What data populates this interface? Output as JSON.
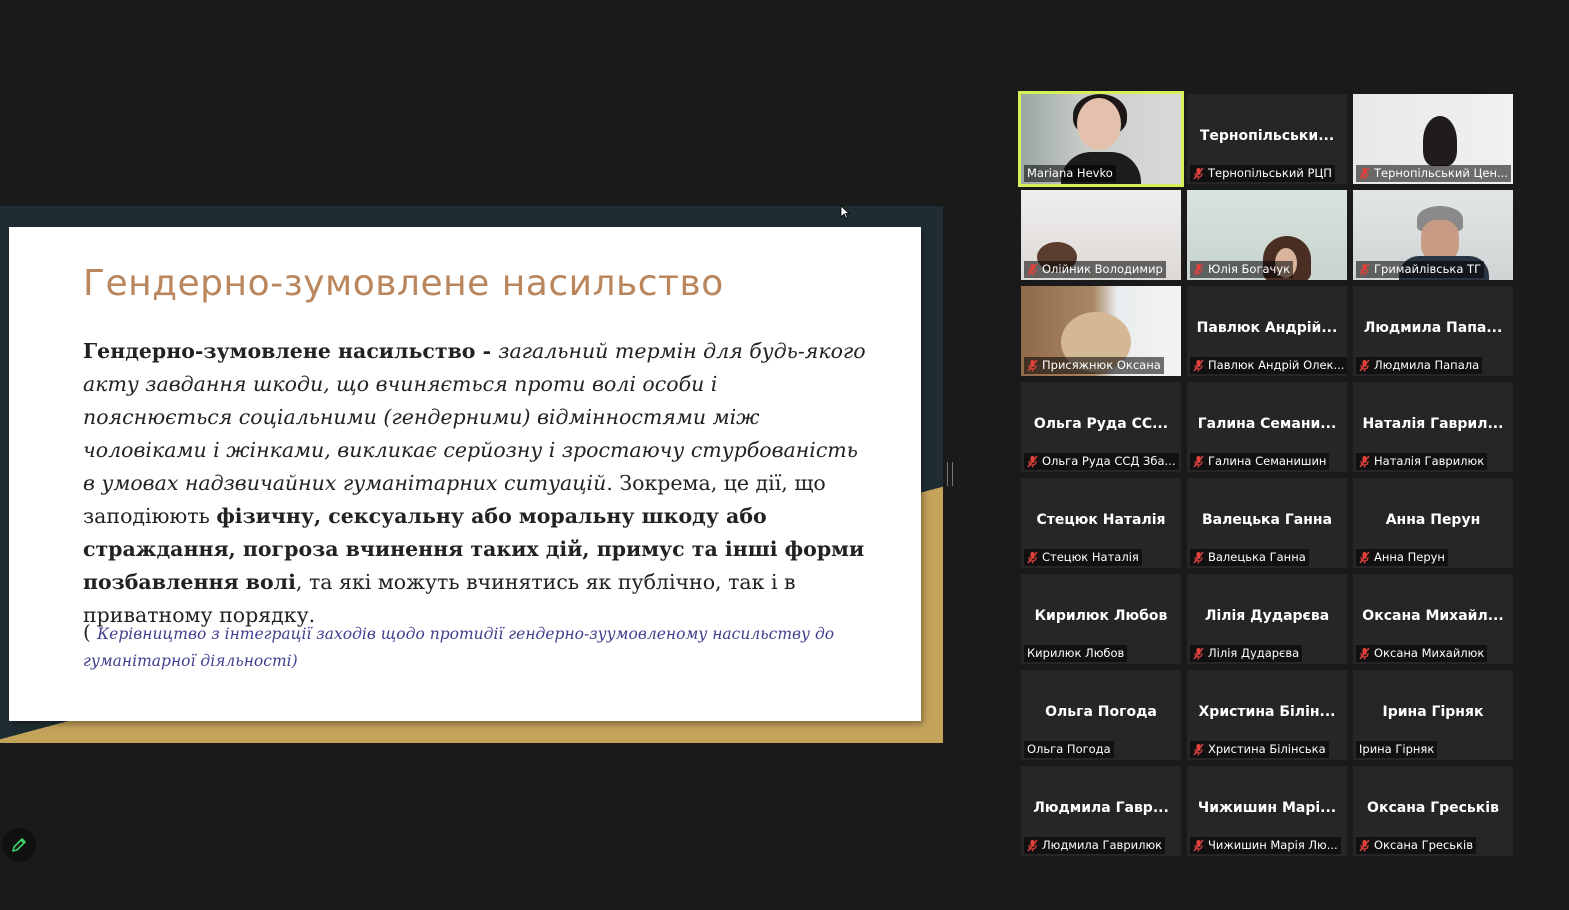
{
  "slide": {
    "title": "Гендерно-зумовлене насильство",
    "body": {
      "term_bold": "Гендерно-зумовлене насильство - ",
      "definition_italic": "загальний термін для будь-якого акту завдання шкоди, що вчиняється проти волі особи і пояснюється соціальними (гендерними) відмінностями між чоловіками і жінками, викликає серйозну і зростаючу стурбованість в умовах надзвичайних гуманітарних ситуацій",
      "text_a": ". Зокрема, це дії, що заподіюють ",
      "harms_bold": "фізичну, сексуальну або моральну шкоду або страждання, погроза вчинення таких дій, примус та інші форми позбавлення волі",
      "text_b": ", та які можуть вчинятись як публічно, так і в приватному порядку."
    },
    "source": {
      "open_paren": "( ",
      "text": "Керівництво з інтеграції заходів щодо протидії гендерно-зуумовленому насильству до гуманітарної діяльності",
      "close_paren": ")"
    }
  },
  "participants": [
    {
      "label": "Mariana Hevko",
      "big": "",
      "muted": false,
      "video": "v1",
      "active": true
    },
    {
      "label": "Тернопільський РЦП",
      "big": "Тернопільськи...",
      "muted": true,
      "video": "",
      "active": false
    },
    {
      "label": "Тернопільський Цен...",
      "big": "",
      "muted": true,
      "video": "v3",
      "active": false
    },
    {
      "label": "Олійник Володимир",
      "big": "",
      "muted": true,
      "video": "v4",
      "active": false
    },
    {
      "label": "Юлія Богачук",
      "big": "",
      "muted": true,
      "video": "v5",
      "active": false
    },
    {
      "label": "Гримайлівська ТГ",
      "big": "",
      "muted": true,
      "video": "v6",
      "active": false
    },
    {
      "label": "Присяжнюк Оксана",
      "big": "",
      "muted": true,
      "video": "v7",
      "active": false
    },
    {
      "label": "Павлюк Андрій Олек...",
      "big": "Павлюк  Андрій...",
      "muted": true,
      "video": "",
      "active": false
    },
    {
      "label": "Людмила Папала",
      "big": "Людмила  Папа...",
      "muted": true,
      "video": "",
      "active": false
    },
    {
      "label": "Ольга Руда ССД Зба...",
      "big": "Ольга  Руда  СС...",
      "muted": true,
      "video": "",
      "active": false
    },
    {
      "label": "Галина Семанишин",
      "big": "Галина  Семани...",
      "muted": true,
      "video": "",
      "active": false
    },
    {
      "label": "Наталія Гаврилюк",
      "big": "Наталія  Гаврил...",
      "muted": true,
      "video": "",
      "active": false
    },
    {
      "label": "Стецюк Наталія",
      "big": "Стецюк Наталія",
      "muted": true,
      "video": "",
      "active": false
    },
    {
      "label": "Валецька Ганна",
      "big": "Валецька Ганна",
      "muted": true,
      "video": "",
      "active": false
    },
    {
      "label": "Анна Перун",
      "big": "Анна Перун",
      "muted": true,
      "video": "",
      "active": false
    },
    {
      "label": "Кирилюк Любов",
      "big": "Кирилюк Любов",
      "muted": false,
      "video": "",
      "active": false
    },
    {
      "label": "Лілія Дударєва",
      "big": "Лілія  Дударєва",
      "muted": true,
      "video": "",
      "active": false
    },
    {
      "label": "Оксана Михайлюк",
      "big": "Оксана  Михайл...",
      "muted": true,
      "video": "",
      "active": false
    },
    {
      "label": "Ольга Погода",
      "big": "Ольга Погода",
      "muted": false,
      "video": "",
      "active": false
    },
    {
      "label": "Христина Білінська",
      "big": "Христина  Білін...",
      "muted": true,
      "video": "",
      "active": false
    },
    {
      "label": "Ірина Гірняк",
      "big": "Ірина Гірняк",
      "muted": false,
      "video": "",
      "active": false
    },
    {
      "label": "Людмила Гаврилюк",
      "big": "Людмила  Гавр...",
      "muted": true,
      "video": "",
      "active": false
    },
    {
      "label": "Чижишин Марія Лю...",
      "big": "Чижишин  Марі...",
      "muted": true,
      "video": "",
      "active": false
    },
    {
      "label": "Оксана Греськів",
      "big": "Оксана  Греськів",
      "muted": true,
      "video": "",
      "active": false
    }
  ],
  "colors": {
    "background": "#1a1a1a",
    "tile": "#262626",
    "active_speaker": "#d6f05a",
    "muted_icon": "#e0423b",
    "slide_title": "#b9865d",
    "source_text": "#3f3f8f"
  },
  "icons": {
    "mute": "microphone-muted-icon",
    "annotate": "pencil-icon",
    "cursor": "mouse-pointer-icon"
  }
}
